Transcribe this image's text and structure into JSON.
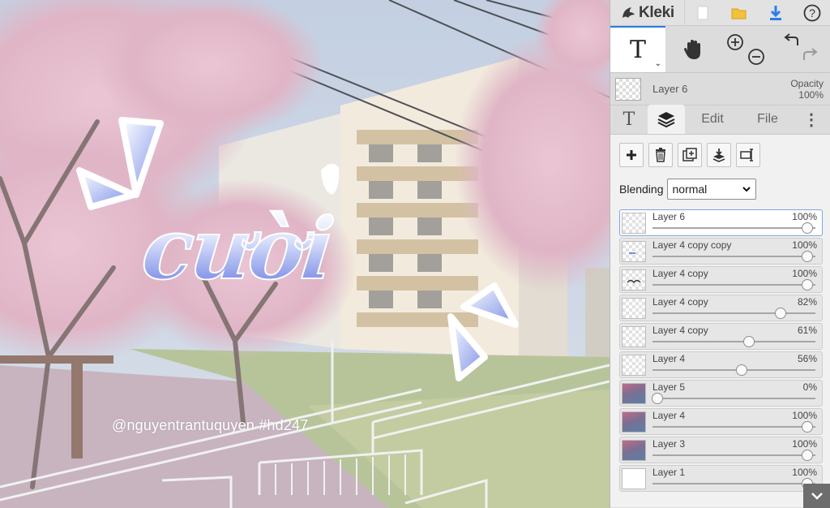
{
  "app": {
    "name": "Kleki"
  },
  "canvas": {
    "word_art": "cười",
    "watermark": "@nguyentrantuquyen  #hd247"
  },
  "toolbar": {
    "icons": [
      "new-image-icon",
      "open-folder-icon",
      "download-icon",
      "help-icon"
    ],
    "tools": [
      "text-tool-icon",
      "hand-tool-icon",
      "zoom-in-icon",
      "zoom-out-icon",
      "undo-icon",
      "redo-icon"
    ]
  },
  "active_layer": {
    "name": "Layer 6",
    "opacity_label": "Opacity",
    "opacity_value": "100%"
  },
  "tabs": {
    "text": "T",
    "edit": "Edit",
    "file": "File",
    "more": "⋮"
  },
  "layer_buttons": [
    "add-layer-icon",
    "delete-layer-icon",
    "duplicate-layer-icon",
    "merge-down-icon",
    "rename-layer-icon"
  ],
  "blending": {
    "label": "Blending",
    "value": "normal"
  },
  "layers": [
    {
      "name": "Layer 6",
      "opacity": "100%",
      "level": 1.0,
      "selected": true,
      "thumb": "transparent"
    },
    {
      "name": "Layer 4 copy copy",
      "opacity": "100%",
      "level": 1.0,
      "selected": false,
      "thumb": "transparent-mark"
    },
    {
      "name": "Layer 4 copy",
      "opacity": "100%",
      "level": 1.0,
      "selected": false,
      "thumb": "transparent-text"
    },
    {
      "name": "Layer 4 copy",
      "opacity": "82%",
      "level": 0.82,
      "selected": false,
      "thumb": "transparent"
    },
    {
      "name": "Layer 4 copy",
      "opacity": "61%",
      "level": 0.61,
      "selected": false,
      "thumb": "transparent"
    },
    {
      "name": "Layer 4",
      "opacity": "56%",
      "level": 0.56,
      "selected": false,
      "thumb": "transparent"
    },
    {
      "name": "Layer 5",
      "opacity": "0%",
      "level": 0.0,
      "selected": false,
      "thumb": "photo"
    },
    {
      "name": "Layer 4",
      "opacity": "100%",
      "level": 1.0,
      "selected": false,
      "thumb": "photo"
    },
    {
      "name": "Layer 3",
      "opacity": "100%",
      "level": 1.0,
      "selected": false,
      "thumb": "photo"
    },
    {
      "name": "Layer 1",
      "opacity": "100%",
      "level": 1.0,
      "selected": false,
      "thumb": "white"
    }
  ],
  "colors": {
    "accent": "#2b7de9",
    "word_art_gradient_end": "#7d8ee6",
    "sky": "#aebfd8",
    "blossom": "#e0b2c4"
  }
}
